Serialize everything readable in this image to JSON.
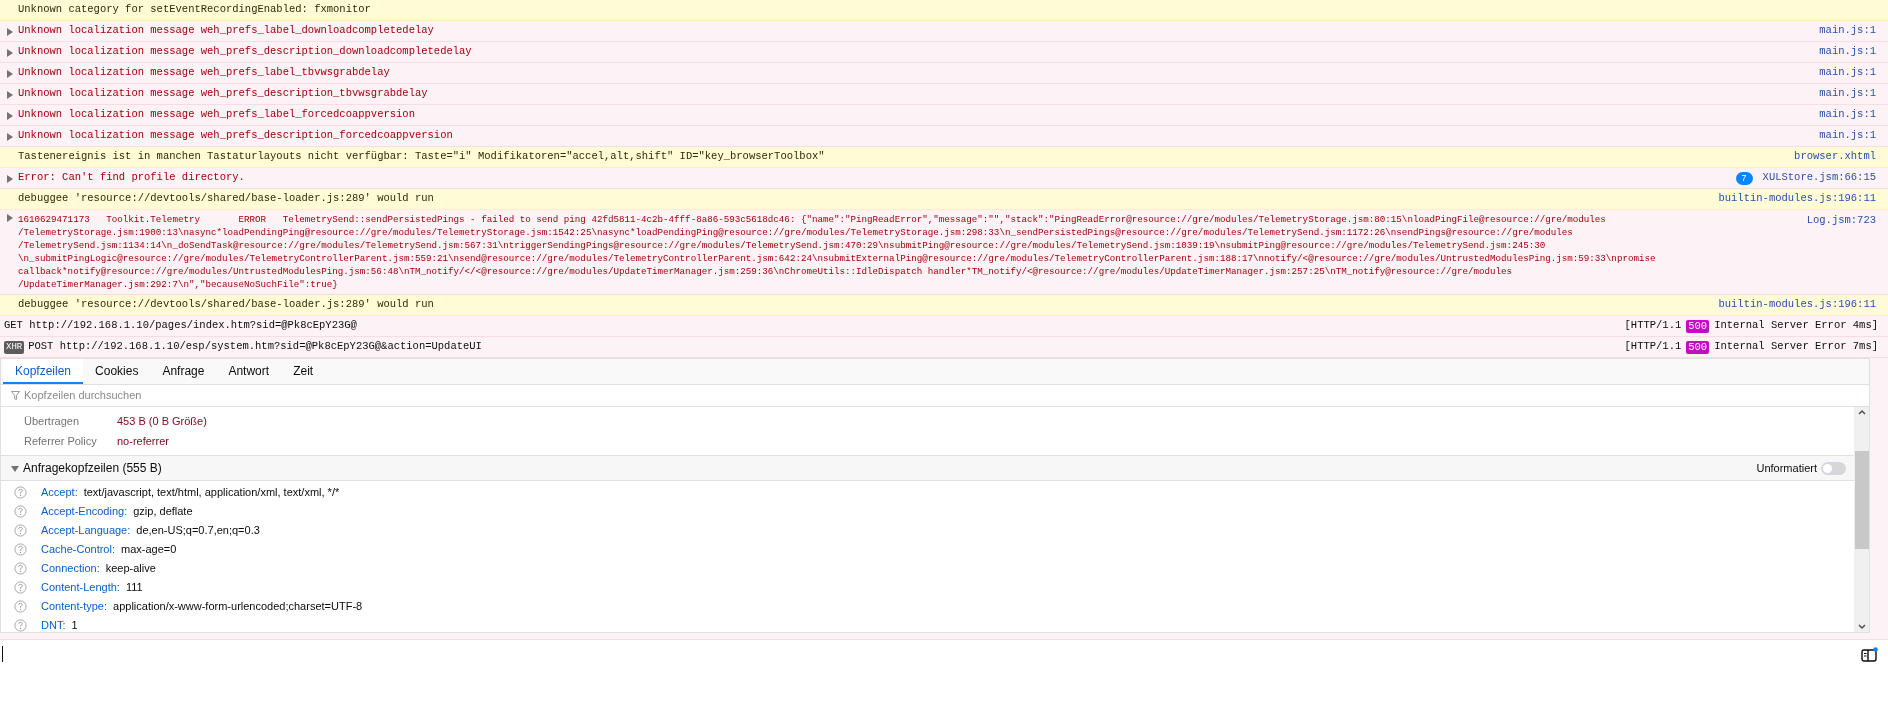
{
  "console": {
    "messages": [
      {
        "kind": "warning",
        "expandable": false,
        "text": "Unknown category for setEventRecordingEnabled: fxmonitor"
      },
      {
        "kind": "error",
        "expandable": true,
        "text": "Unknown localization message weh_prefs_label_downloadcompletedelay",
        "source": "main.js:1"
      },
      {
        "kind": "error",
        "expandable": true,
        "text": "Unknown localization message weh_prefs_description_downloadcompletedelay",
        "source": "main.js:1"
      },
      {
        "kind": "error",
        "expandable": true,
        "text": "Unknown localization message weh_prefs_label_tbvwsgrabdelay",
        "source": "main.js:1"
      },
      {
        "kind": "error",
        "expandable": true,
        "text": "Unknown localization message weh_prefs_description_tbvwsgrabdelay",
        "source": "main.js:1"
      },
      {
        "kind": "error",
        "expandable": true,
        "text": "Unknown localization message weh_prefs_label_forcedcoappversion",
        "source": "main.js:1"
      },
      {
        "kind": "error",
        "expandable": true,
        "text": "Unknown localization message weh_prefs_description_forcedcoappversion",
        "source": "main.js:1"
      },
      {
        "kind": "warning",
        "expandable": false,
        "text": "Tastenereignis ist in manchen Tastaturlayouts nicht verfügbar: Taste=\"i\" Modifikatoren=\"accel,alt,shift\" ID=\"key_browserToolbox\"",
        "source": "browser.xhtml"
      },
      {
        "kind": "error",
        "expandable": true,
        "text": "Error: Can't find profile directory.",
        "repeat_count": "7",
        "source": "XULStore.jsm:66:15"
      },
      {
        "kind": "warning",
        "expandable": false,
        "text": "debuggee 'resource://devtools/shared/base-loader.js:289' would run",
        "source": "builtin-modules.js:196:11"
      },
      {
        "kind": "error",
        "expandable": true,
        "lines": [
          "1610629471173   Toolkit.Telemetry       ERROR   TelemetrySend::sendPersistedPings - failed to send ping 42fd5811-4c2b-4fff-8a86-593c5618dc46: {\"name\":\"PingReadError\",\"message\":\"\",\"stack\":\"PingReadError@resource://gre/modules/TelemetryStorage.jsm:80:15\\nloadPingFile@resource://gre/modules",
          "/TelemetryStorage.jsm:1900:13\\nasync*loadPendingPing@resource://gre/modules/TelemetryStorage.jsm:1542:25\\nasync*loadPendingPing@resource://gre/modules/TelemetryStorage.jsm:298:33\\n_sendPersistedPings@resource://gre/modules/TelemetrySend.jsm:1172:26\\nsendPings@resource://gre/modules",
          "/TelemetrySend.jsm:1134:14\\n_doSendTask@resource://gre/modules/TelemetrySend.jsm:567:31\\ntriggerSendingPings@resource://gre/modules/TelemetrySend.jsm:470:29\\nsubmitPing@resource://gre/modules/TelemetrySend.jsm:1039:19\\nsubmitPing@resource://gre/modules/TelemetrySend.jsm:245:30",
          "\\n_submitPingLogic@resource://gre/modules/TelemetryControllerParent.jsm:559:21\\nsend@resource://gre/modules/TelemetryControllerParent.jsm:642:24\\nsubmitExternalPing@resource://gre/modules/TelemetryControllerParent.jsm:188:17\\nnotify/<@resource://gre/modules/UntrustedModulesPing.jsm:59:33\\npromise",
          "callback*notify@resource://gre/modules/UntrustedModulesPing.jsm:56:48\\nTM_notify/</<@resource://gre/modules/UpdateTimerManager.jsm:259:36\\nChromeUtils::IdleDispatch handler*TM_notify/<@resource://gre/modules/UpdateTimerManager.jsm:257:25\\nTM_notify@resource://gre/modules",
          "/UpdateTimerManager.jsm:292:7\\n\",\"becauseNoSuchFile\":true}"
        ],
        "source": "Log.jsm:723"
      },
      {
        "kind": "warning",
        "expandable": false,
        "text": "debuggee 'resource://devtools/shared/base-loader.js:289' would run",
        "source": "builtin-modules.js:196:11"
      },
      {
        "kind": "network",
        "method": "GET",
        "url": "http://192.168.1.10/pages/index.htm?sid=@Pk8cEpY23G@",
        "status_prefix": "[HTTP/1.1",
        "status_code": "500",
        "status_suffix": "Internal Server Error 4ms]"
      },
      {
        "kind": "network",
        "badge": "XHR",
        "method": "POST",
        "url": "http://192.168.1.10/esp/system.htm?sid=@Pk8cEpY23G@&action=UpdateUI",
        "status_prefix": "[HTTP/1.1",
        "status_code": "500",
        "status_suffix": "Internal Server Error 7ms]"
      }
    ]
  },
  "details": {
    "tabs": [
      {
        "label": "Kopfzeilen",
        "selected": true
      },
      {
        "label": "Cookies",
        "selected": false
      },
      {
        "label": "Anfrage",
        "selected": false
      },
      {
        "label": "Antwort",
        "selected": false
      },
      {
        "label": "Zeit",
        "selected": false
      }
    ],
    "filter": {
      "placeholder": "Kopfzeilen durchsuchen"
    },
    "summary": [
      {
        "label": "Übertragen",
        "value": "453 B (0 B Größe)"
      },
      {
        "label": "Referrer Policy",
        "value": "no-referrer"
      }
    ],
    "section": {
      "title": "Anfragekopfzeilen (555 B)",
      "expanded": true,
      "raw_toggle": {
        "label": "Unformatiert",
        "on": false
      }
    },
    "headers": [
      {
        "name": "Accept:",
        "value": "text/javascript, text/html, application/xml, text/xml, */*"
      },
      {
        "name": "Accept-Encoding:",
        "value": "gzip, deflate"
      },
      {
        "name": "Accept-Language:",
        "value": "de,en-US;q=0.7,en;q=0.3"
      },
      {
        "name": "Cache-Control:",
        "value": "max-age=0"
      },
      {
        "name": "Connection:",
        "value": "keep-alive"
      },
      {
        "name": "Content-Length:",
        "value": "111"
      },
      {
        "name": "Content-type:",
        "value": "application/x-www-form-urlencoded;charset=UTF-8"
      },
      {
        "name": "DNT:",
        "value": "1"
      }
    ]
  }
}
